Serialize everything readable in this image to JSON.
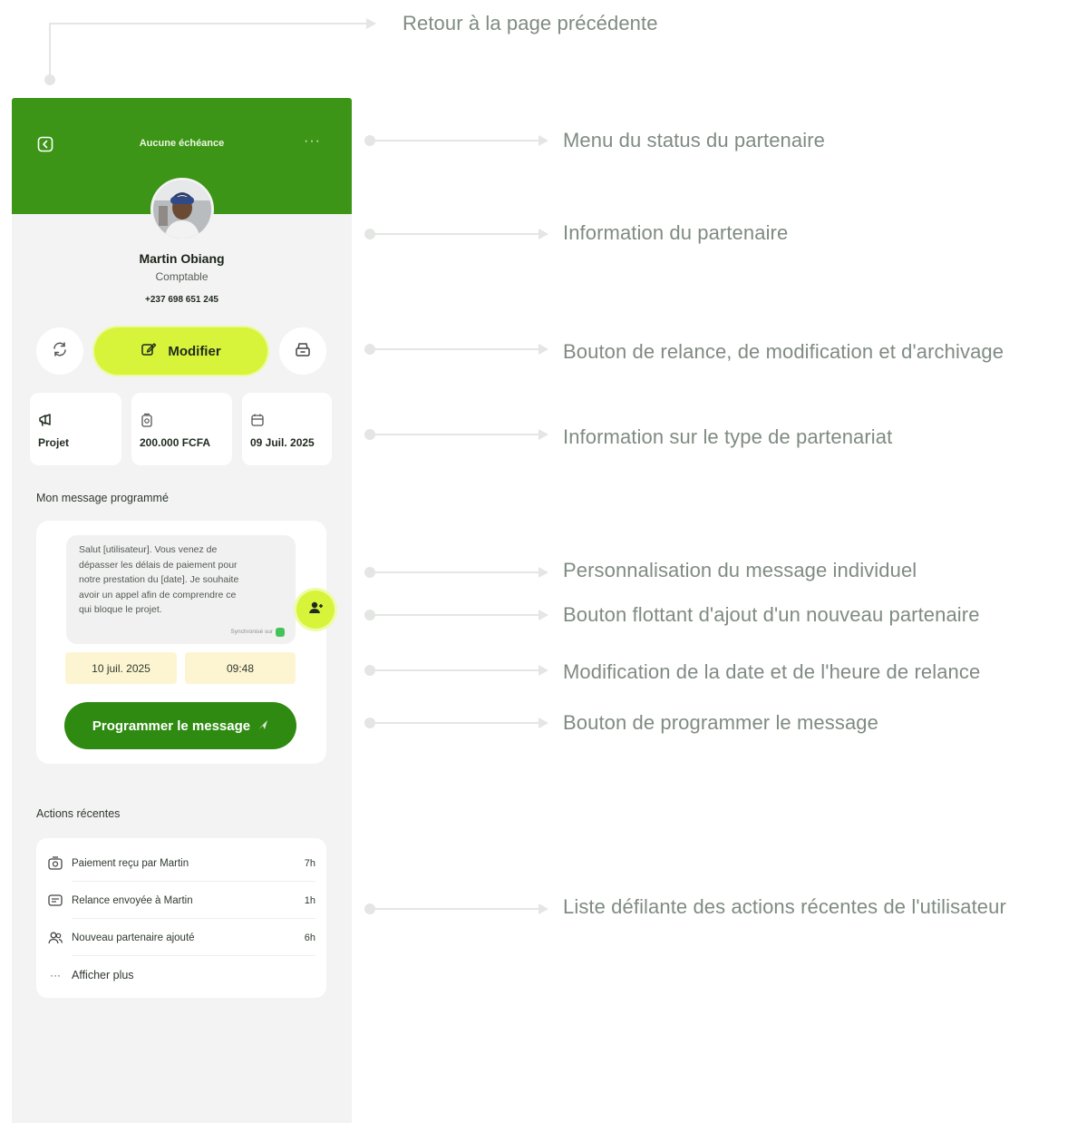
{
  "annotations": [
    {
      "id": "back",
      "text": "Retour à la page précédente"
    },
    {
      "id": "status-menu",
      "text": "Menu du status du partenaire"
    },
    {
      "id": "partner-info",
      "text": "Information du partenaire"
    },
    {
      "id": "buttons",
      "text": "Bouton de relance, de modification et d'archivage"
    },
    {
      "id": "partnership-type",
      "text": "Information sur le type de partenariat"
    },
    {
      "id": "personalisation",
      "text": "Personnalisation du message individuel"
    },
    {
      "id": "fab",
      "text": "Bouton flottant d'ajout d'un nouveau partenaire"
    },
    {
      "id": "date-time",
      "text": "Modification de la date et de l'heure de relance"
    },
    {
      "id": "schedule",
      "text": "Bouton de programmer le message"
    },
    {
      "id": "recent",
      "text": "Liste défilante des actions récentes de l'utilisateur"
    }
  ],
  "header": {
    "title": "Aucune échéance",
    "back_icon": "back-arrow-icon",
    "more_icon": "more-dots-icon",
    "more_label": "···"
  },
  "partner": {
    "name": "Martin Obiang",
    "role": "Comptable",
    "phone": "+237 698 651 245"
  },
  "buttons": {
    "relaunch_icon": "refresh-icon",
    "modify_label": "Modifier",
    "modify_icon": "edit-icon",
    "archive_icon": "archive-icon"
  },
  "info_cards": [
    {
      "icon": "megaphone-icon",
      "value": "Projet"
    },
    {
      "icon": "money-icon",
      "value": "200.000 FCFA"
    },
    {
      "icon": "calendar-icon",
      "value": "09 Juil. 2025"
    }
  ],
  "scheduled": {
    "title": "Mon message programmé",
    "lines": [
      "Salut [utilisateur]. Vous venez de",
      "dépasser les délais de paiement pour",
      "notre prestation du  [date]. Je souhaite",
      "avoir un appel afin de comprendre ce",
      "qui bloque le projet."
    ],
    "sync_label": "Synchronisé sur",
    "date": "10 juil. 2025",
    "time": "09:48",
    "button_label": "Programmer le message"
  },
  "recent": {
    "title": "Actions récentes",
    "items": [
      {
        "icon": "payment-icon",
        "label": "Paiement reçu par Martin",
        "time": "7h"
      },
      {
        "icon": "message-icon",
        "label": "Relance envoyée à Martin",
        "time": "1h"
      },
      {
        "icon": "users-icon",
        "label": "Nouveau partenaire ajouté",
        "time": "6h"
      }
    ],
    "more_icon_label": "···",
    "more_label": "Afficher plus"
  },
  "colors": {
    "header_green": "#3c9516",
    "accent_lime": "#d7f43a",
    "button_green": "#2f8a12",
    "pill_yellow": "#fdf5d1",
    "annotation_text": "#7f8b82"
  }
}
